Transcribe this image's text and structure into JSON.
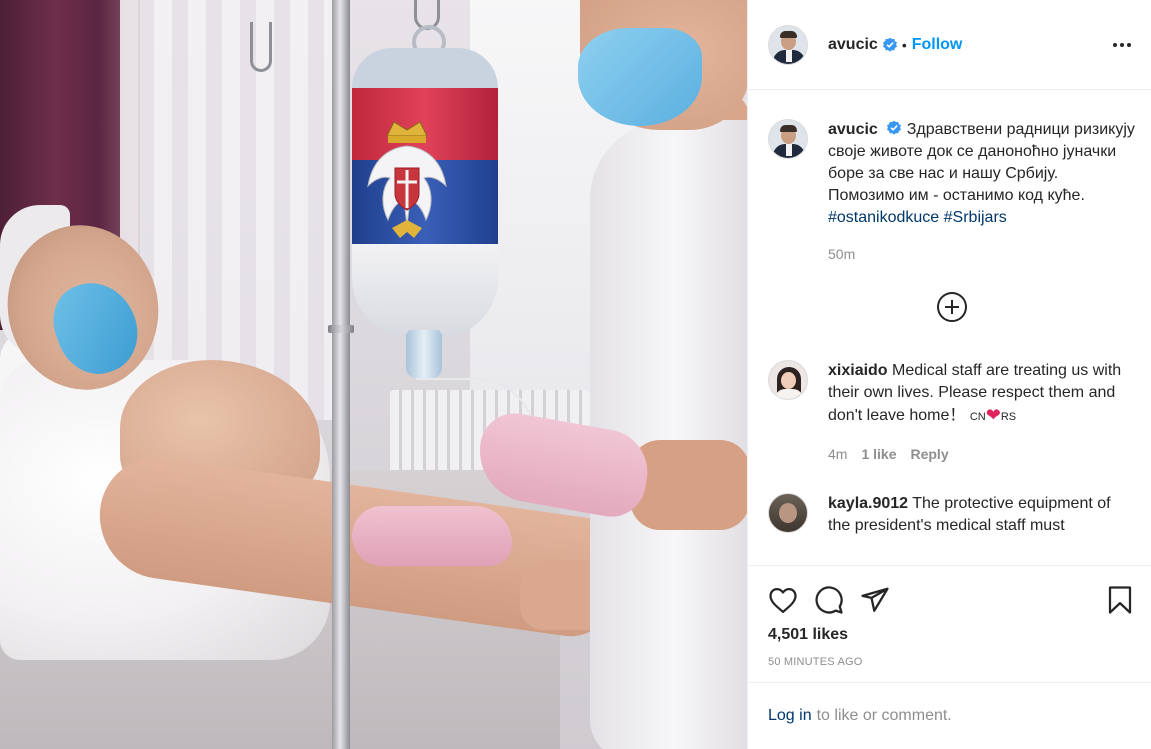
{
  "header": {
    "username": "avucic",
    "separator": "•",
    "follow_label": "Follow",
    "more_icon": "more-horizontal-icon"
  },
  "caption": {
    "username": "avucic",
    "text": "Здравствени радници ризикују своје животе док се даноноћно јуначки боре за све нас и нашу Србију. Помозимо им - останимо код куће.",
    "tag1": "#ostanikodkuce",
    "tag2": "#Srbijars",
    "time": "50m"
  },
  "comments": [
    {
      "username": "xixiaido",
      "text": "Medical staff are treating us with their own lives. Please respect them and don't leave home！",
      "flag_left": "CN",
      "flag_right": "RS",
      "time": "4m",
      "likes": "1 like",
      "reply": "Reply"
    },
    {
      "username": "kayla.9012",
      "text": "The protective equipment of the president's medical staff must"
    }
  ],
  "actions": {
    "likes_count": "4,501 likes",
    "posted_ago": "50 MINUTES AGO"
  },
  "login": {
    "link_text": "Log in",
    "rest_text": "to like or comment."
  },
  "colors": {
    "accent": "#0095f6",
    "link": "#00376b",
    "muted": "#8e8e8e",
    "text": "#262626",
    "flag_red": "#c6363c",
    "flag_blue": "#0c4076",
    "flag_white": "#ffffff"
  }
}
